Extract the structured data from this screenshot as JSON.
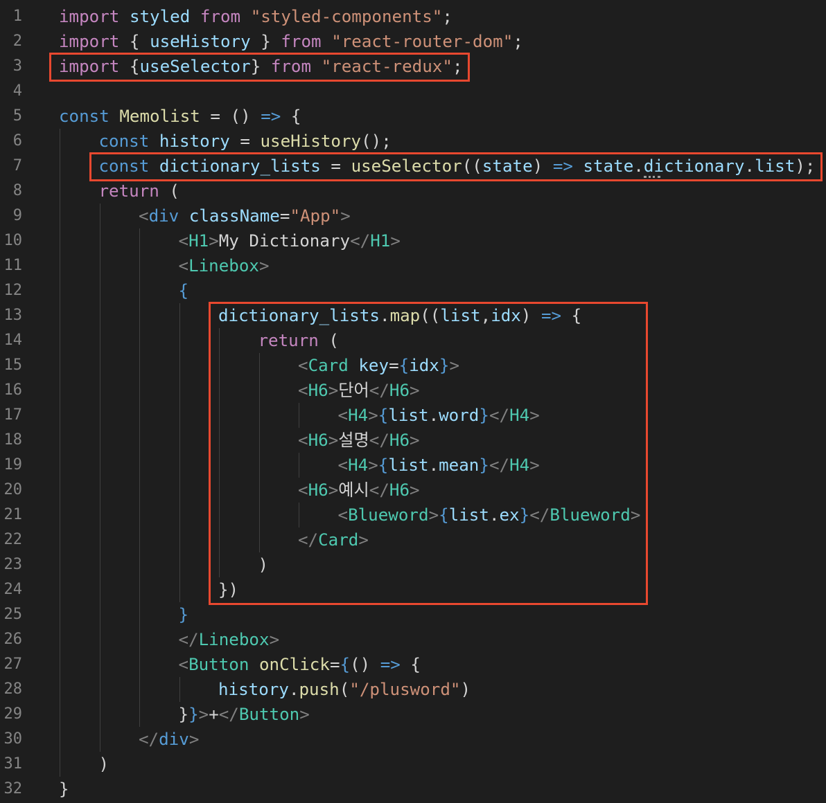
{
  "editor": {
    "lines": [
      {
        "n": "1",
        "indent": 0,
        "tokens": [
          [
            "kw",
            "import"
          ],
          [
            "txt",
            " "
          ],
          [
            "var",
            "styled"
          ],
          [
            "txt",
            " "
          ],
          [
            "kw",
            "from"
          ],
          [
            "txt",
            " "
          ],
          [
            "str",
            "\"styled-components\""
          ],
          [
            "txt",
            ";"
          ]
        ]
      },
      {
        "n": "2",
        "indent": 0,
        "tokens": [
          [
            "kw",
            "import"
          ],
          [
            "txt",
            " { "
          ],
          [
            "var",
            "useHistory"
          ],
          [
            "txt",
            " } "
          ],
          [
            "kw",
            "from"
          ],
          [
            "txt",
            " "
          ],
          [
            "str",
            "\"react-router-dom\""
          ],
          [
            "txt",
            ";"
          ]
        ]
      },
      {
        "n": "3",
        "indent": 0,
        "tokens": [
          [
            "kw",
            "import"
          ],
          [
            "txt",
            " {"
          ],
          [
            "var",
            "useSelector"
          ],
          [
            "txt",
            "} "
          ],
          [
            "kw",
            "from"
          ],
          [
            "txt",
            " "
          ],
          [
            "str",
            "\"react-redux\""
          ],
          [
            "txt",
            ";"
          ]
        ]
      },
      {
        "n": "4",
        "indent": 0,
        "tokens": []
      },
      {
        "n": "5",
        "indent": 0,
        "tokens": [
          [
            "stor",
            "const"
          ],
          [
            "txt",
            " "
          ],
          [
            "fn",
            "Memolist"
          ],
          [
            "txt",
            " = () "
          ],
          [
            "arrow",
            "=>"
          ],
          [
            "txt",
            " {"
          ]
        ]
      },
      {
        "n": "6",
        "indent": 1,
        "tokens": [
          [
            "stor",
            "const"
          ],
          [
            "txt",
            " "
          ],
          [
            "var",
            "history"
          ],
          [
            "txt",
            " = "
          ],
          [
            "fn",
            "useHistory"
          ],
          [
            "txt",
            "();"
          ]
        ]
      },
      {
        "n": "7",
        "indent": 1,
        "tokens": [
          [
            "stor",
            "const"
          ],
          [
            "txt",
            " "
          ],
          [
            "var",
            "dictionary_lists"
          ],
          [
            "txt",
            " = "
          ],
          [
            "fn",
            "useSelector"
          ],
          [
            "txt",
            "(("
          ],
          [
            "var",
            "state"
          ],
          [
            "txt",
            ") "
          ],
          [
            "arrow",
            "=>"
          ],
          [
            "txt",
            " "
          ],
          [
            "var",
            "state"
          ],
          [
            "txt",
            "."
          ],
          [
            "prop",
            "dictionary"
          ],
          [
            "txt",
            "."
          ],
          [
            "prop",
            "list"
          ],
          [
            "txt",
            ");"
          ]
        ]
      },
      {
        "n": "8",
        "indent": 1,
        "tokens": [
          [
            "kw",
            "return"
          ],
          [
            "txt",
            " ("
          ]
        ]
      },
      {
        "n": "9",
        "indent": 2,
        "tokens": [
          [
            "br",
            "<"
          ],
          [
            "jsx",
            "div"
          ],
          [
            "txt",
            " "
          ],
          [
            "attr",
            "className"
          ],
          [
            "txt",
            "="
          ],
          [
            "str",
            "\"App\""
          ],
          [
            "br",
            ">"
          ]
        ]
      },
      {
        "n": "10",
        "indent": 3,
        "tokens": [
          [
            "br",
            "<"
          ],
          [
            "tag",
            "H1"
          ],
          [
            "br",
            ">"
          ],
          [
            "txt",
            "My Dictionary"
          ],
          [
            "br",
            "</"
          ],
          [
            "tag",
            "H1"
          ],
          [
            "br",
            ">"
          ]
        ]
      },
      {
        "n": "11",
        "indent": 3,
        "tokens": [
          [
            "br",
            "<"
          ],
          [
            "tag",
            "Linebox"
          ],
          [
            "br",
            ">"
          ]
        ]
      },
      {
        "n": "12",
        "indent": 3,
        "tokens": [
          [
            "emb",
            "{"
          ]
        ]
      },
      {
        "n": "13",
        "indent": 4,
        "tokens": [
          [
            "var",
            "dictionary_lists"
          ],
          [
            "txt",
            "."
          ],
          [
            "fn",
            "map"
          ],
          [
            "txt",
            "(("
          ],
          [
            "var",
            "list"
          ],
          [
            "txt",
            ","
          ],
          [
            "var",
            "idx"
          ],
          [
            "txt",
            ") "
          ],
          [
            "arrow",
            "=>"
          ],
          [
            "txt",
            " {"
          ]
        ]
      },
      {
        "n": "14",
        "indent": 5,
        "tokens": [
          [
            "kw",
            "return"
          ],
          [
            "txt",
            " ("
          ]
        ]
      },
      {
        "n": "15",
        "indent": 6,
        "tokens": [
          [
            "br",
            "<"
          ],
          [
            "tag",
            "Card"
          ],
          [
            "txt",
            " "
          ],
          [
            "attr",
            "key"
          ],
          [
            "txt",
            "="
          ],
          [
            "emb",
            "{"
          ],
          [
            "var",
            "idx"
          ],
          [
            "emb",
            "}"
          ],
          [
            "br",
            ">"
          ]
        ]
      },
      {
        "n": "16",
        "indent": 6,
        "tokens": [
          [
            "br",
            "<"
          ],
          [
            "tag",
            "H6"
          ],
          [
            "br",
            ">"
          ],
          [
            "txt",
            "단어"
          ],
          [
            "br",
            "</"
          ],
          [
            "tag",
            "H6"
          ],
          [
            "br",
            ">"
          ]
        ]
      },
      {
        "n": "17",
        "indent": 7,
        "tokens": [
          [
            "br",
            "<"
          ],
          [
            "tag",
            "H4"
          ],
          [
            "br",
            ">"
          ],
          [
            "emb",
            "{"
          ],
          [
            "var",
            "list"
          ],
          [
            "txt",
            "."
          ],
          [
            "prop",
            "word"
          ],
          [
            "emb",
            "}"
          ],
          [
            "br",
            "</"
          ],
          [
            "tag",
            "H4"
          ],
          [
            "br",
            ">"
          ]
        ]
      },
      {
        "n": "18",
        "indent": 6,
        "tokens": [
          [
            "br",
            "<"
          ],
          [
            "tag",
            "H6"
          ],
          [
            "br",
            ">"
          ],
          [
            "txt",
            "설명"
          ],
          [
            "br",
            "</"
          ],
          [
            "tag",
            "H6"
          ],
          [
            "br",
            ">"
          ]
        ]
      },
      {
        "n": "19",
        "indent": 7,
        "tokens": [
          [
            "br",
            "<"
          ],
          [
            "tag",
            "H4"
          ],
          [
            "br",
            ">"
          ],
          [
            "emb",
            "{"
          ],
          [
            "var",
            "list"
          ],
          [
            "txt",
            "."
          ],
          [
            "prop",
            "mean"
          ],
          [
            "emb",
            "}"
          ],
          [
            "br",
            "</"
          ],
          [
            "tag",
            "H4"
          ],
          [
            "br",
            ">"
          ]
        ]
      },
      {
        "n": "20",
        "indent": 6,
        "tokens": [
          [
            "br",
            "<"
          ],
          [
            "tag",
            "H6"
          ],
          [
            "br",
            ">"
          ],
          [
            "txt",
            "예시"
          ],
          [
            "br",
            "</"
          ],
          [
            "tag",
            "H6"
          ],
          [
            "br",
            ">"
          ]
        ]
      },
      {
        "n": "21",
        "indent": 7,
        "tokens": [
          [
            "br",
            "<"
          ],
          [
            "tag",
            "Blueword"
          ],
          [
            "br",
            ">"
          ],
          [
            "emb",
            "{"
          ],
          [
            "var",
            "list"
          ],
          [
            "txt",
            "."
          ],
          [
            "prop",
            "ex"
          ],
          [
            "emb",
            "}"
          ],
          [
            "br",
            "</"
          ],
          [
            "tag",
            "Blueword"
          ],
          [
            "br",
            ">"
          ]
        ]
      },
      {
        "n": "22",
        "indent": 6,
        "tokens": [
          [
            "br",
            "</"
          ],
          [
            "tag",
            "Card"
          ],
          [
            "br",
            ">"
          ]
        ]
      },
      {
        "n": "23",
        "indent": 5,
        "tokens": [
          [
            "txt",
            ")"
          ]
        ]
      },
      {
        "n": "24",
        "indent": 4,
        "tokens": [
          [
            "txt",
            "})"
          ]
        ]
      },
      {
        "n": "25",
        "indent": 3,
        "tokens": [
          [
            "emb",
            "}"
          ]
        ]
      },
      {
        "n": "26",
        "indent": 3,
        "tokens": [
          [
            "br",
            "</"
          ],
          [
            "tag",
            "Linebox"
          ],
          [
            "br",
            ">"
          ]
        ]
      },
      {
        "n": "27",
        "indent": 3,
        "tokens": [
          [
            "br",
            "<"
          ],
          [
            "tag",
            "Button"
          ],
          [
            "txt",
            " "
          ],
          [
            "fn",
            "onClick"
          ],
          [
            "txt",
            "="
          ],
          [
            "emb",
            "{"
          ],
          [
            "txt",
            "() "
          ],
          [
            "arrow",
            "=>"
          ],
          [
            "txt",
            " {"
          ]
        ]
      },
      {
        "n": "28",
        "indent": 4,
        "tokens": [
          [
            "var",
            "history"
          ],
          [
            "txt",
            "."
          ],
          [
            "fn",
            "push"
          ],
          [
            "txt",
            "("
          ],
          [
            "str",
            "\"/plusword\""
          ],
          [
            "txt",
            ")"
          ]
        ]
      },
      {
        "n": "29",
        "indent": 3,
        "tokens": [
          [
            "txt",
            "}"
          ],
          [
            "emb",
            "}"
          ],
          [
            "br",
            ">"
          ],
          [
            "txt",
            "+"
          ],
          [
            "br",
            "</"
          ],
          [
            "tag",
            "Button"
          ],
          [
            "br",
            ">"
          ]
        ]
      },
      {
        "n": "30",
        "indent": 2,
        "tokens": [
          [
            "br",
            "</"
          ],
          [
            "jsx",
            "div"
          ],
          [
            "br",
            ">"
          ]
        ]
      },
      {
        "n": "31",
        "indent": 1,
        "tokens": [
          [
            "txt",
            ")"
          ]
        ]
      },
      {
        "n": "32",
        "indent": 0,
        "tokens": [
          [
            "txt",
            "}"
          ]
        ]
      }
    ],
    "highlights": [
      {
        "name": "highlight-import-useselector",
        "from": 3,
        "to": 3
      },
      {
        "name": "highlight-useselector-call",
        "from": 7,
        "to": 7
      },
      {
        "name": "highlight-map-block",
        "from": 13,
        "to": 24
      }
    ],
    "colors": {
      "background": "#1e1e1e",
      "line_number": "#858585",
      "highlight_border": "#e8482f",
      "keyword": "#c586c0",
      "storage": "#569cd6",
      "variable": "#9cdcfe",
      "function": "#dcdcaa",
      "string": "#ce9178",
      "component_tag": "#4ec9b0",
      "bracket": "#808080"
    }
  }
}
